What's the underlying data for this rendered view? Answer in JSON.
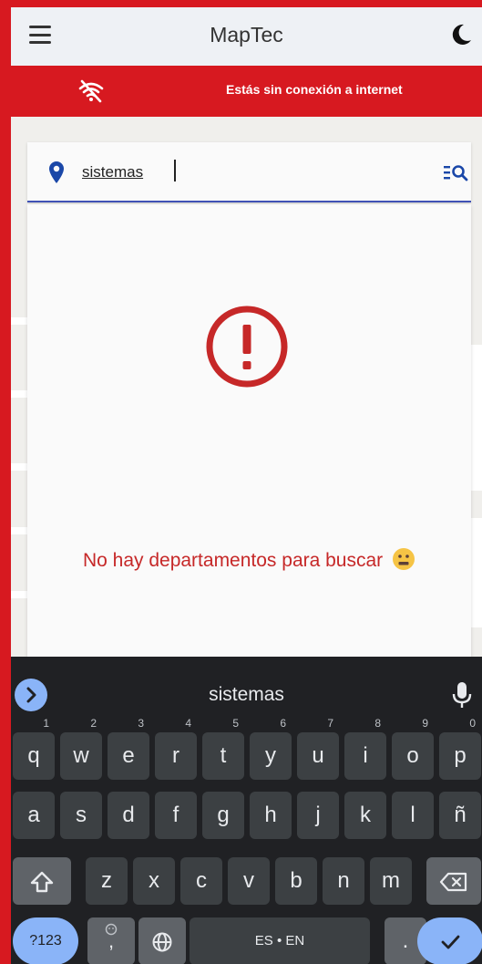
{
  "app": {
    "title": "MapTec"
  },
  "banner": {
    "offline_text": "Estás sin conexión a internet"
  },
  "search": {
    "value": "sistemas"
  },
  "results": {
    "empty_message": "No hay departamentos para buscar"
  },
  "keyboard": {
    "suggestion": "sistemas",
    "row1": [
      {
        "label": "q",
        "hint": "1"
      },
      {
        "label": "w",
        "hint": "2"
      },
      {
        "label": "e",
        "hint": "3"
      },
      {
        "label": "r",
        "hint": "4"
      },
      {
        "label": "t",
        "hint": "5"
      },
      {
        "label": "y",
        "hint": "6"
      },
      {
        "label": "u",
        "hint": "7"
      },
      {
        "label": "i",
        "hint": "8"
      },
      {
        "label": "o",
        "hint": "9"
      },
      {
        "label": "p",
        "hint": "0"
      }
    ],
    "row2": [
      "a",
      "s",
      "d",
      "f",
      "g",
      "h",
      "j",
      "k",
      "l",
      "ñ"
    ],
    "row3": [
      "z",
      "x",
      "c",
      "v",
      "b",
      "n",
      "m"
    ],
    "numbers_label": "?123",
    "comma_label": ",",
    "space_label": "ES • EN",
    "period_label": "."
  },
  "colors": {
    "brand_red": "#d71920",
    "accent_blue": "#3f51b5",
    "error_red": "#c62828"
  },
  "icons": [
    "menu-icon",
    "dark-mode-icon",
    "wifi-off-icon",
    "location-pin-icon",
    "list-search-icon",
    "alert-icon",
    "emoji-icon",
    "expand-icon",
    "mic-icon",
    "shift-icon",
    "backspace-icon",
    "globe-icon",
    "check-icon"
  ]
}
